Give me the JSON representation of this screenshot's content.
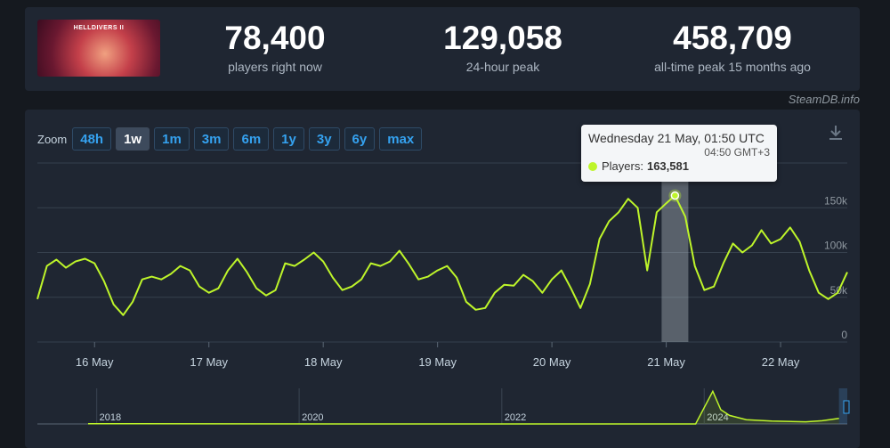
{
  "stats": [
    {
      "value": "78,400",
      "label": "players right now"
    },
    {
      "value": "129,058",
      "label": "24-hour peak"
    },
    {
      "value": "458,709",
      "label": "all-time peak 15 months ago"
    }
  ],
  "thumbnail": {
    "logo_text": "HELLDIVERS II"
  },
  "credit": "SteamDB.info",
  "zoom": {
    "label": "Zoom",
    "buttons": [
      "48h",
      "1w",
      "1m",
      "3m",
      "6m",
      "1y",
      "3y",
      "6y",
      "max"
    ],
    "active": "1w"
  },
  "tooltip": {
    "title": "Wednesday 21 May, 01:50 UTC",
    "subtitle": "04:50 GMT+3",
    "series_label": "Players:",
    "value": "163,581"
  },
  "colors": {
    "line": "#bef52a",
    "accent": "#35a2f0",
    "highlight": "#c7d0d8"
  },
  "icons": {
    "download": "download-icon"
  },
  "chart_data": [
    {
      "type": "line",
      "title": "",
      "x_ticks": [
        "16 May",
        "17 May",
        "18 May",
        "19 May",
        "20 May",
        "21 May",
        "22 May"
      ],
      "y_ticks": [
        {
          "value": 0,
          "label": "0"
        },
        {
          "value": 50000,
          "label": "50k"
        },
        {
          "value": 100000,
          "label": "100k"
        },
        {
          "value": 150000,
          "label": "150k"
        }
      ],
      "ylim": [
        0,
        200000
      ],
      "grid": true,
      "highlight_point": {
        "x": "2025-05-21 01:50",
        "y": 163581
      },
      "series": [
        {
          "name": "Players",
          "x": [
            "2025-05-15 12:00",
            "2025-05-15 14:00",
            "2025-05-15 16:00",
            "2025-05-15 18:00",
            "2025-05-15 20:00",
            "2025-05-15 22:00",
            "2025-05-16 00:00",
            "2025-05-16 02:00",
            "2025-05-16 04:00",
            "2025-05-16 06:00",
            "2025-05-16 08:00",
            "2025-05-16 10:00",
            "2025-05-16 12:00",
            "2025-05-16 14:00",
            "2025-05-16 16:00",
            "2025-05-16 18:00",
            "2025-05-16 20:00",
            "2025-05-16 22:00",
            "2025-05-17 00:00",
            "2025-05-17 02:00",
            "2025-05-17 04:00",
            "2025-05-17 06:00",
            "2025-05-17 08:00",
            "2025-05-17 10:00",
            "2025-05-17 12:00",
            "2025-05-17 14:00",
            "2025-05-17 16:00",
            "2025-05-17 18:00",
            "2025-05-17 20:00",
            "2025-05-17 22:00",
            "2025-05-18 00:00",
            "2025-05-18 02:00",
            "2025-05-18 04:00",
            "2025-05-18 06:00",
            "2025-05-18 08:00",
            "2025-05-18 10:00",
            "2025-05-18 12:00",
            "2025-05-18 14:00",
            "2025-05-18 16:00",
            "2025-05-18 18:00",
            "2025-05-18 20:00",
            "2025-05-18 22:00",
            "2025-05-19 00:00",
            "2025-05-19 02:00",
            "2025-05-19 04:00",
            "2025-05-19 06:00",
            "2025-05-19 08:00",
            "2025-05-19 10:00",
            "2025-05-19 12:00",
            "2025-05-19 14:00",
            "2025-05-19 16:00",
            "2025-05-19 18:00",
            "2025-05-19 20:00",
            "2025-05-19 22:00",
            "2025-05-20 00:00",
            "2025-05-20 02:00",
            "2025-05-20 04:00",
            "2025-05-20 06:00",
            "2025-05-20 08:00",
            "2025-05-20 10:00",
            "2025-05-20 12:00",
            "2025-05-20 14:00",
            "2025-05-20 16:00",
            "2025-05-20 18:00",
            "2025-05-20 20:00",
            "2025-05-20 22:00",
            "2025-05-21 00:00",
            "2025-05-21 01:50",
            "2025-05-21 04:00",
            "2025-05-21 06:00",
            "2025-05-21 08:00",
            "2025-05-21 10:00",
            "2025-05-21 12:00",
            "2025-05-21 14:00",
            "2025-05-21 16:00",
            "2025-05-21 18:00",
            "2025-05-21 20:00",
            "2025-05-21 22:00",
            "2025-05-22 00:00",
            "2025-05-22 02:00",
            "2025-05-22 04:00",
            "2025-05-22 06:00",
            "2025-05-22 08:00",
            "2025-05-22 10:00",
            "2025-05-22 12:00",
            "2025-05-22 14:00"
          ],
          "y": [
            48000,
            85000,
            92000,
            83000,
            90000,
            93000,
            88000,
            68000,
            42000,
            30000,
            45000,
            70000,
            73000,
            70000,
            76000,
            85000,
            80000,
            62000,
            55000,
            60000,
            80000,
            93000,
            78000,
            60000,
            52000,
            58000,
            88000,
            85000,
            92000,
            100000,
            90000,
            72000,
            58000,
            62000,
            70000,
            88000,
            85000,
            90000,
            102000,
            87000,
            70000,
            73000,
            80000,
            85000,
            72000,
            45000,
            36000,
            38000,
            55000,
            64000,
            63000,
            75000,
            68000,
            55000,
            70000,
            80000,
            60000,
            38000,
            65000,
            115000,
            135000,
            145000,
            160000,
            150000,
            80000,
            145000,
            155000,
            163581,
            140000,
            85000,
            58000,
            62000,
            88000,
            110000,
            100000,
            108000,
            125000,
            110000,
            115000,
            128000,
            112000,
            80000,
            55000,
            48000,
            55000,
            78000
          ]
        }
      ]
    },
    {
      "type": "area",
      "title": "",
      "x_ticks": [
        "2018",
        "2020",
        "2022",
        "2024"
      ],
      "series": [
        {
          "name": "Players",
          "x": [
            "2017-12",
            "2018-06",
            "2020-06",
            "2022-06",
            "2023-12",
            "2024-02",
            "2024-03",
            "2024-04",
            "2024-06",
            "2024-09",
            "2025-01",
            "2025-03",
            "2025-05"
          ],
          "y": [
            2000,
            2000,
            0,
            0,
            0,
            458709,
            200000,
            120000,
            60000,
            40000,
            30000,
            45000,
            78400
          ]
        }
      ]
    }
  ]
}
